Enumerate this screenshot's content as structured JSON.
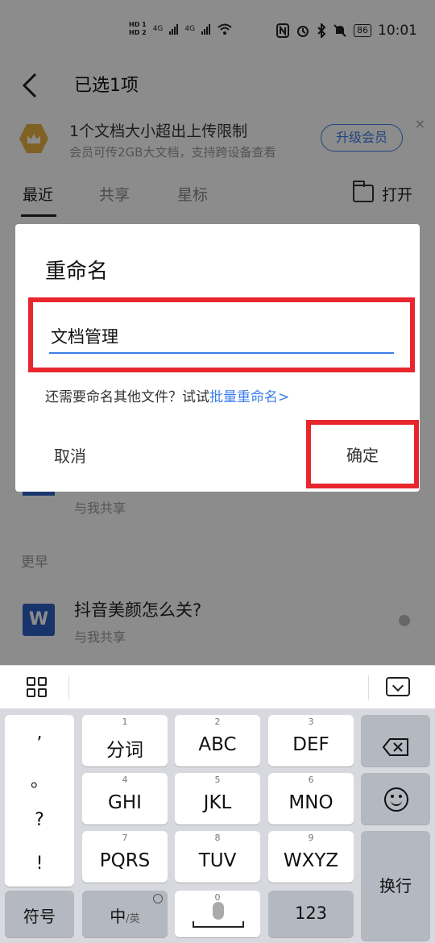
{
  "status_bar": {
    "hd1": "HD 1",
    "hd2": "HD 2",
    "net1": "4G",
    "net2": "4G",
    "battery": "86",
    "time": "10:01"
  },
  "header": {
    "title": "已选1项"
  },
  "banner": {
    "title": "1个文档大小超出上传限制",
    "subtitle": "会员可传2GB大文档，支持跨设备查看",
    "upgrade_label": "升级会员",
    "close_label": "×"
  },
  "tabs": {
    "items": [
      {
        "label": "最近"
      },
      {
        "label": "共享"
      },
      {
        "label": "星标"
      }
    ],
    "open_label": "打开"
  },
  "list": {
    "item1_sub": "与我共享",
    "section_earlier": "更早",
    "item2_name": "抖音美颜怎么关?",
    "item2_sub": "与我共享",
    "item2_thumb": "W"
  },
  "dialog": {
    "title": "重命名",
    "input_value": "文档管理",
    "hint_prefix": "还需要命名其他文件？试试",
    "hint_link": "批量重命名>",
    "cancel_label": "取消",
    "confirm_label": "确定"
  },
  "keyboard": {
    "punct": [
      ",",
      "。",
      "?",
      "!"
    ],
    "keys_row1": [
      {
        "num": "1",
        "label": "分词"
      },
      {
        "num": "2",
        "label": "ABC"
      },
      {
        "num": "3",
        "label": "DEF"
      }
    ],
    "keys_row2": [
      {
        "num": "4",
        "label": "GHI"
      },
      {
        "num": "5",
        "label": "JKL"
      },
      {
        "num": "6",
        "label": "MNO"
      }
    ],
    "keys_row3": [
      {
        "num": "7",
        "label": "PQRS"
      },
      {
        "num": "8",
        "label": "TUV"
      },
      {
        "num": "9",
        "label": "WXYZ"
      }
    ],
    "symbol_label": "符号",
    "lang_main": "中",
    "lang_alt": "/英",
    "space_num": "0",
    "num_label": "123",
    "enter_label": "换行"
  },
  "colors": {
    "accent": "#3b7de8",
    "highlight_frame": "#e8262d"
  }
}
